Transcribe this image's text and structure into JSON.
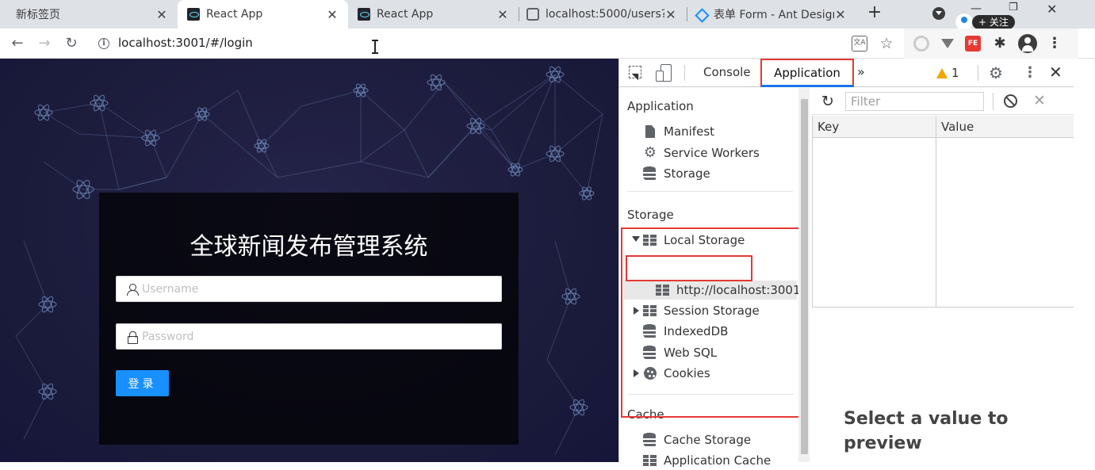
{
  "browser": {
    "tabs": [
      {
        "title": "新标签页",
        "favicon": "none"
      },
      {
        "title": "React App",
        "favicon": "react-icon"
      },
      {
        "title": "React App",
        "favicon": "react-icon"
      },
      {
        "title": "localhost:5000/users?_e",
        "favicon": "globe-icon"
      },
      {
        "title": "表单 Form - Ant Design",
        "favicon": "antd-icon"
      }
    ],
    "active_tab_index": 1,
    "new_tab_label": "+",
    "follow_button": "+ 关注",
    "address": "localhost:3001/#/login"
  },
  "page": {
    "login": {
      "title": "全球新闻发布管理系统",
      "username_placeholder": "Username",
      "password_placeholder": "Password",
      "submit_label": "登录"
    }
  },
  "devtools": {
    "tabs": {
      "console": "Console",
      "application": "Application"
    },
    "active_tab": "Application",
    "warnings_count": "1",
    "sidebar": {
      "application_header": "Application",
      "application_items": [
        "Manifest",
        "Service Workers",
        "Storage"
      ],
      "storage_header": "Storage",
      "local_storage": "Local Storage",
      "local_storage_origin": "http://localhost:3001",
      "session_storage": "Session Storage",
      "indexeddb": "IndexedDB",
      "websql": "Web SQL",
      "cookies": "Cookies",
      "cache_header": "Cache",
      "cache_storage": "Cache Storage",
      "application_cache": "Application Cache"
    },
    "main": {
      "filter_placeholder": "Filter",
      "columns": {
        "key": "Key",
        "value": "Value"
      },
      "rows": [],
      "preview_placeholder": "Select a value to preview"
    }
  },
  "colors": {
    "highlight_box": "#e53935",
    "active_tab_underline": "#1a73e8",
    "login_button": "#1890ff",
    "page_background": "#1a1a3a",
    "warning": "#f2a600"
  }
}
